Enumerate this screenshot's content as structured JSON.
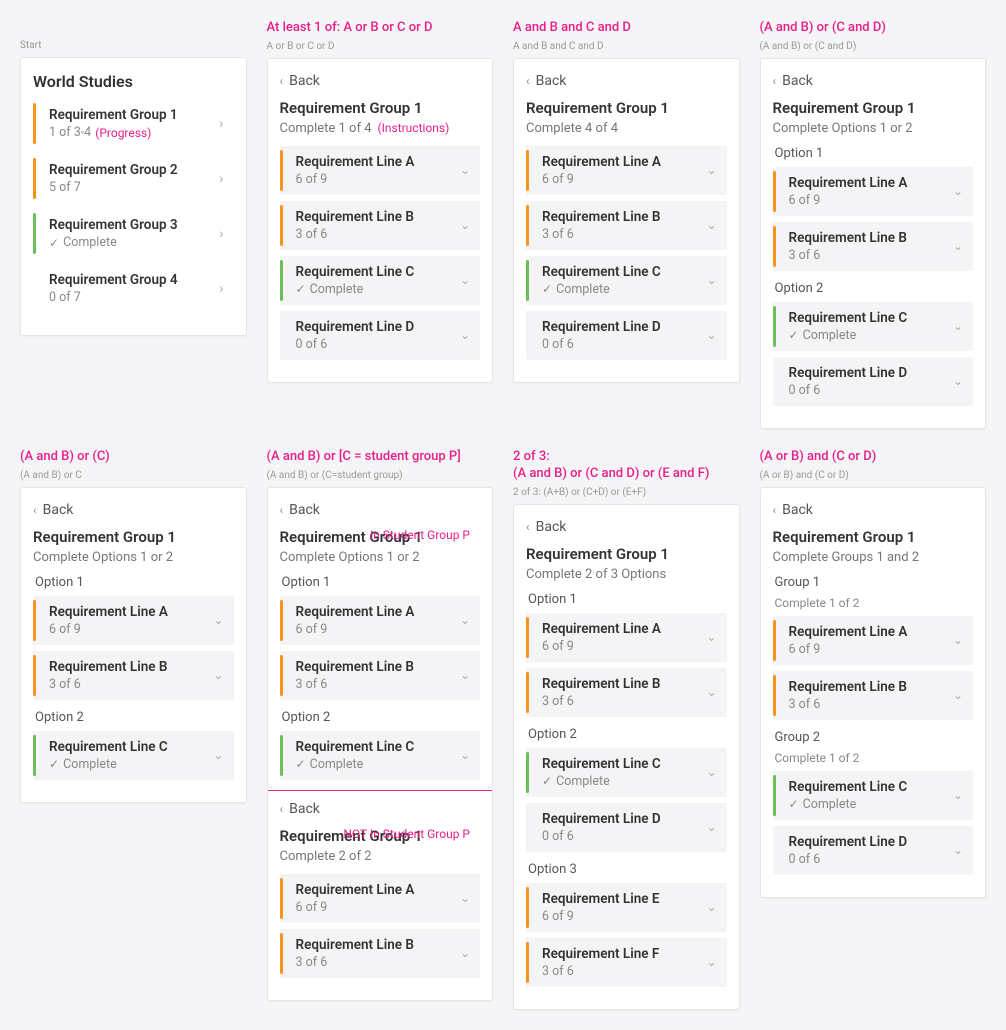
{
  "labels": {
    "back": "Back",
    "complete": "Complete"
  },
  "cells": [
    {
      "heading": "",
      "subheading": "Start",
      "panels": [
        {
          "back": false,
          "title": "World Studies",
          "instructions": "",
          "rows": [
            {
              "stripe": "orange",
              "bg": "white",
              "title": "Requirement Group 1",
              "sub": "1 of 3-4",
              "subNote": "(Progress)",
              "chev": "right"
            },
            {
              "stripe": "orange",
              "bg": "white",
              "title": "Requirement Group 2",
              "sub": "5 of 7",
              "chev": "right"
            },
            {
              "stripe": "green",
              "bg": "white",
              "title": "Requirement Group 3",
              "sub": "Complete",
              "check": true,
              "chev": "right"
            },
            {
              "stripe": "none",
              "bg": "white",
              "title": "Requirement Group 4",
              "sub": "0 of 7",
              "chev": "right"
            }
          ]
        }
      ]
    },
    {
      "heading": "At least 1 of: A or B or C or D",
      "subheading": "A or B or C or D",
      "panels": [
        {
          "back": true,
          "pageTitle": "Requirement Group 1",
          "instructions": "Complete 1 of 4",
          "instructionsNote": "(Instructions)",
          "rows": [
            {
              "stripe": "orange",
              "bg": "grey",
              "title": "Requirement Line A",
              "sub": "6 of 9",
              "chev": "down"
            },
            {
              "stripe": "orange",
              "bg": "grey",
              "title": "Requirement Line B",
              "sub": "3 of 6",
              "chev": "down"
            },
            {
              "stripe": "green",
              "bg": "grey",
              "title": "Requirement Line C",
              "sub": "Complete",
              "check": true,
              "chev": "down"
            },
            {
              "stripe": "none",
              "bg": "grey",
              "title": "Requirement Line D",
              "sub": "0 of 6",
              "chev": "down"
            }
          ]
        }
      ]
    },
    {
      "heading": "A and B and C and D",
      "subheading": "A and B and C and D",
      "panels": [
        {
          "back": true,
          "pageTitle": "Requirement Group 1",
          "instructions": "Complete 4 of 4",
          "rows": [
            {
              "stripe": "orange",
              "bg": "grey",
              "title": "Requirement Line A",
              "sub": "6 of 9",
              "chev": "down"
            },
            {
              "stripe": "orange",
              "bg": "grey",
              "title": "Requirement Line B",
              "sub": "3 of 6",
              "chev": "down"
            },
            {
              "stripe": "green",
              "bg": "grey",
              "title": "Requirement Line C",
              "sub": "Complete",
              "check": true,
              "chev": "down"
            },
            {
              "stripe": "none",
              "bg": "grey",
              "title": "Requirement Line D",
              "sub": "0 of 6",
              "chev": "down"
            }
          ]
        }
      ]
    },
    {
      "heading": "(A and B) or (C and D)",
      "subheading": "(A and B) or (C and D)",
      "panels": [
        {
          "back": true,
          "pageTitle": "Requirement Group 1",
          "instructions": "Complete Options 1 or 2",
          "sections": [
            {
              "label": "Option 1",
              "rows": [
                {
                  "stripe": "orange",
                  "bg": "grey",
                  "title": "Requirement Line A",
                  "sub": "6 of 9",
                  "chev": "down"
                },
                {
                  "stripe": "orange",
                  "bg": "grey",
                  "title": "Requirement Line B",
                  "sub": "3 of 6",
                  "chev": "down"
                }
              ]
            },
            {
              "label": "Option 2",
              "rows": [
                {
                  "stripe": "green",
                  "bg": "grey",
                  "title": "Requirement Line C",
                  "sub": "Complete",
                  "check": true,
                  "chev": "down"
                },
                {
                  "stripe": "none",
                  "bg": "grey",
                  "title": "Requirement Line D",
                  "sub": "0 of 6",
                  "chev": "down"
                }
              ]
            }
          ]
        }
      ]
    },
    {
      "heading": "(A and B) or (C)",
      "subheading": "(A and B) or C",
      "panels": [
        {
          "back": true,
          "pageTitle": "Requirement Group 1",
          "instructions": "Complete Options 1 or 2",
          "sections": [
            {
              "label": "Option 1",
              "rows": [
                {
                  "stripe": "orange",
                  "bg": "grey",
                  "title": "Requirement Line A",
                  "sub": "6 of 9",
                  "chev": "down"
                },
                {
                  "stripe": "orange",
                  "bg": "grey",
                  "title": "Requirement Line B",
                  "sub": "3 of 6",
                  "chev": "down"
                }
              ]
            },
            {
              "label": "Option 2",
              "rows": [
                {
                  "stripe": "green",
                  "bg": "grey",
                  "title": "Requirement Line C",
                  "sub": "Complete",
                  "check": true,
                  "chev": "down"
                }
              ]
            }
          ]
        }
      ]
    },
    {
      "heading": "(A and B) or [C = student group P]",
      "subheading": "(A and B) or (C=student group)",
      "panels": [
        {
          "back": true,
          "pageTitle": "Requirement Group 1",
          "sideNote": "In Student Group P",
          "instructions": "Complete Options 1 or 2",
          "sections": [
            {
              "label": "Option 1",
              "rows": [
                {
                  "stripe": "orange",
                  "bg": "grey",
                  "title": "Requirement Line A",
                  "sub": "6 of 9",
                  "chev": "down"
                },
                {
                  "stripe": "orange",
                  "bg": "grey",
                  "title": "Requirement Line B",
                  "sub": "3 of 6",
                  "chev": "down"
                }
              ]
            },
            {
              "label": "Option 2",
              "rows": [
                {
                  "stripe": "green",
                  "bg": "grey",
                  "title": "Requirement Line C",
                  "sub": "Complete",
                  "check": true,
                  "chev": "down"
                }
              ]
            }
          ],
          "divider": true,
          "secondPanel": {
            "back": true,
            "pageTitle": "Requirement Group 1",
            "sideNote": "NOT In Student Group P",
            "instructions": "Complete 2 of 2",
            "rows": [
              {
                "stripe": "orange",
                "bg": "grey",
                "title": "Requirement Line A",
                "sub": "6 of 9",
                "chev": "down"
              },
              {
                "stripe": "orange",
                "bg": "grey",
                "title": "Requirement Line B",
                "sub": "3 of 6",
                "chev": "down"
              }
            ]
          }
        }
      ]
    },
    {
      "heading": "2 of 3:\n(A and B) or (C and D) or (E and F)",
      "subheading": "2 of 3: (A+B) or (C+D) or (E+F)",
      "panels": [
        {
          "back": true,
          "pageTitle": "Requirement Group 1",
          "instructions": "Complete 2 of 3 Options",
          "sections": [
            {
              "label": "Option 1",
              "rows": [
                {
                  "stripe": "orange",
                  "bg": "grey",
                  "title": "Requirement Line A",
                  "sub": "6 of 9",
                  "chev": "down"
                },
                {
                  "stripe": "orange",
                  "bg": "grey",
                  "title": "Requirement Line B",
                  "sub": "3 of 6",
                  "chev": "down"
                }
              ]
            },
            {
              "label": "Option 2",
              "rows": [
                {
                  "stripe": "green",
                  "bg": "grey",
                  "title": "Requirement Line C",
                  "sub": "Complete",
                  "check": true,
                  "chev": "down"
                },
                {
                  "stripe": "none",
                  "bg": "grey",
                  "title": "Requirement Line D",
                  "sub": "0 of 6",
                  "chev": "down"
                }
              ]
            },
            {
              "label": "Option 3",
              "rows": [
                {
                  "stripe": "orange",
                  "bg": "grey",
                  "title": "Requirement Line E",
                  "sub": "6 of 9",
                  "chev": "down"
                },
                {
                  "stripe": "orange",
                  "bg": "grey",
                  "title": "Requirement Line F",
                  "sub": "3 of 6",
                  "chev": "down"
                }
              ]
            }
          ]
        }
      ]
    },
    {
      "heading": "(A or B) and (C or D)",
      "subheading": "(A or B) and (C or D)",
      "panels": [
        {
          "back": true,
          "pageTitle": "Requirement Group 1",
          "instructions": "Complete Groups 1 and 2",
          "sections": [
            {
              "label": "Group 1",
              "subLabel": "Complete 1 of 2",
              "rows": [
                {
                  "stripe": "orange",
                  "bg": "grey",
                  "title": "Requirement Line A",
                  "sub": "6 of 9",
                  "chev": "down"
                },
                {
                  "stripe": "orange",
                  "bg": "grey",
                  "title": "Requirement Line B",
                  "sub": "3 of 6",
                  "chev": "down"
                }
              ]
            },
            {
              "label": "Group 2",
              "subLabel": "Complete 1 of 2",
              "rows": [
                {
                  "stripe": "green",
                  "bg": "grey",
                  "title": "Requirement Line C",
                  "sub": "Complete",
                  "check": true,
                  "chev": "down"
                },
                {
                  "stripe": "none",
                  "bg": "grey",
                  "title": "Requirement Line D",
                  "sub": "0 of 6",
                  "chev": "down"
                }
              ]
            }
          ]
        }
      ]
    }
  ]
}
